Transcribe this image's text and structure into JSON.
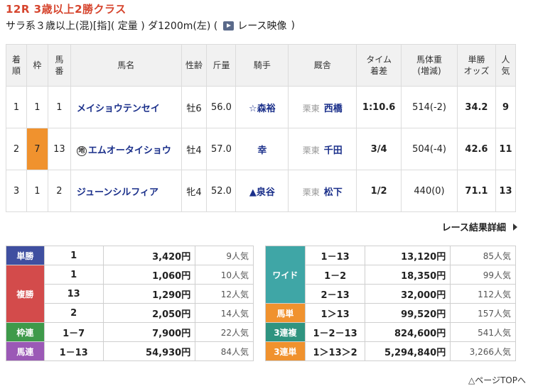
{
  "race": {
    "title": "12R 3歳以上2勝クラス",
    "info": "サラ系３歳以上(混)[指]( 定量 ) ダ1200m(左)  (",
    "video_label": "レース映像",
    "video_close": ")"
  },
  "result_table": {
    "headers": [
      "着順",
      "枠",
      "馬番",
      "馬名",
      "性齢",
      "斤量",
      "騎手",
      "厩舎",
      "タイム着差",
      "馬体重(増減)",
      "単勝オッズ",
      "人気"
    ],
    "header_lines": [
      [
        "着",
        "順"
      ],
      [
        "枠"
      ],
      [
        "馬",
        "番"
      ],
      [
        "馬名"
      ],
      [
        "性齢"
      ],
      [
        "斤量"
      ],
      [
        "騎手"
      ],
      [
        "厩舎"
      ],
      [
        "タイム",
        "着差"
      ],
      [
        "馬体重",
        "(増減)"
      ],
      [
        "単勝",
        "オッズ"
      ],
      [
        "人",
        "気"
      ]
    ],
    "rows": [
      {
        "rank": "1",
        "waku": "1",
        "umaban": "1",
        "mark": "",
        "horse": "メイショウテンセイ",
        "sexage": "牡6",
        "weight": "56.0",
        "jockey": "☆森裕",
        "stable_region": "栗東",
        "trainer": "西橋",
        "time": "1:10.6",
        "body_weight": "514(-2)",
        "odds": "34.2",
        "pop": "9"
      },
      {
        "rank": "2",
        "waku": "7",
        "umaban": "13",
        "mark": "地",
        "horse": "エムオータイショウ",
        "sexage": "牡4",
        "weight": "57.0",
        "jockey": "幸",
        "stable_region": "栗東",
        "trainer": "千田",
        "time": "3/4",
        "body_weight": "504(-4)",
        "odds": "42.6",
        "pop": "11"
      },
      {
        "rank": "3",
        "waku": "1",
        "umaban": "2",
        "mark": "",
        "horse": "ジューンシルフィア",
        "sexage": "牝4",
        "weight": "52.0",
        "jockey": "▲泉谷",
        "stable_region": "栗東",
        "trainer": "松下",
        "time": "1/2",
        "body_weight": "440(0)",
        "odds": "71.1",
        "pop": "13"
      }
    ]
  },
  "detail_link": "レース結果詳細",
  "payouts_left": [
    {
      "type": "単勝",
      "color": "#3f4fa0",
      "entries": [
        {
          "combo": "1",
          "amount": "3,420円",
          "pop": "9人気"
        }
      ]
    },
    {
      "type": "複勝",
      "color": "#d34b4b",
      "entries": [
        {
          "combo": "1",
          "amount": "1,060円",
          "pop": "10人気"
        },
        {
          "combo": "13",
          "amount": "1,290円",
          "pop": "12人気"
        },
        {
          "combo": "2",
          "amount": "2,050円",
          "pop": "14人気"
        }
      ]
    },
    {
      "type": "枠連",
      "color": "#3e9a4a",
      "entries": [
        {
          "combo": "1－7",
          "amount": "7,900円",
          "pop": "22人気"
        }
      ]
    },
    {
      "type": "馬連",
      "color": "#9b59b6",
      "entries": [
        {
          "combo": "1－13",
          "amount": "54,930円",
          "pop": "84人気"
        }
      ]
    }
  ],
  "payouts_right": [
    {
      "type": "ワイド",
      "color": "#3fa6a6",
      "entries": [
        {
          "combo": "1－13",
          "amount": "13,120円",
          "pop": "85人気"
        },
        {
          "combo": "1－2",
          "amount": "18,350円",
          "pop": "99人気"
        },
        {
          "combo": "2－13",
          "amount": "32,000円",
          "pop": "112人気"
        }
      ]
    },
    {
      "type": "馬単",
      "color": "#f0922e",
      "entries": [
        {
          "combo": "1＞13",
          "amount": "99,520円",
          "pop": "157人気"
        }
      ]
    },
    {
      "type": "3連複",
      "color": "#2f9480",
      "entries": [
        {
          "combo": "1－2－13",
          "amount": "824,600円",
          "pop": "541人気"
        }
      ]
    },
    {
      "type": "3連単",
      "color": "#f0922e",
      "entries": [
        {
          "combo": "1＞13＞2",
          "amount": "5,294,840円",
          "pop": "3,266人気"
        }
      ]
    }
  ],
  "page_top": "△ページTOPへ"
}
